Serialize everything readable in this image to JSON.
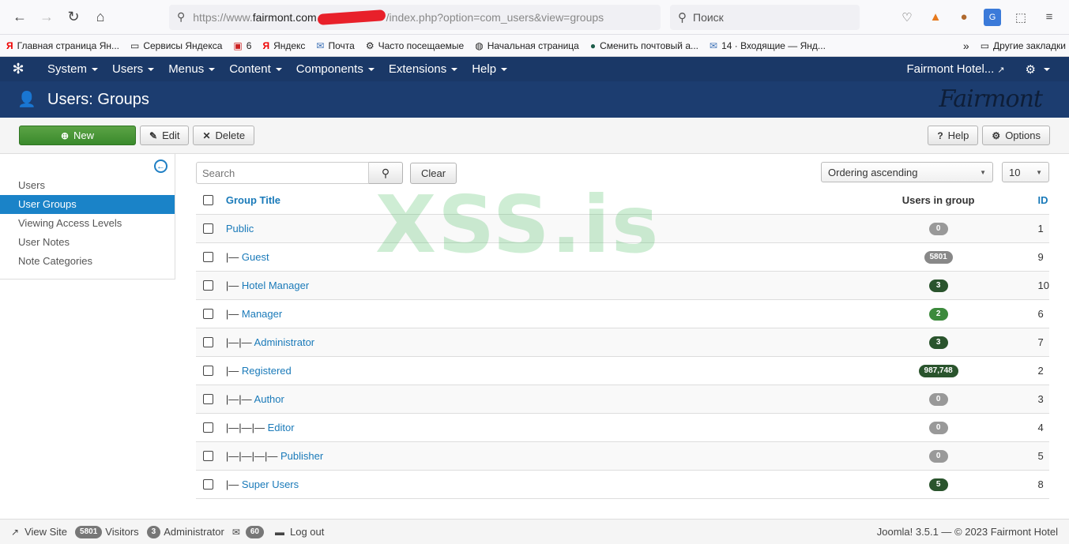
{
  "browser": {
    "url_prefix": "https://www.",
    "url_host": "fairmont.com",
    "url_path": "/index.php?option=com_users&view=groups",
    "search_placeholder": "Поиск",
    "bookmarks": [
      {
        "label": "Главная страница Ян...",
        "icon": "yandex-icon"
      },
      {
        "label": "Сервисы Яндекса",
        "icon": "folder-icon"
      },
      {
        "label": "6",
        "icon": "mail-icon"
      },
      {
        "label": "Яндекс",
        "icon": "yandex-icon"
      },
      {
        "label": "Почта",
        "icon": "mail-icon"
      },
      {
        "label": "Часто посещаемые",
        "icon": "gear-icon"
      },
      {
        "label": "Начальная страница",
        "icon": "globe-icon"
      },
      {
        "label": "Сменить почтовый а...",
        "icon": "site-icon"
      },
      {
        "label": "14 · Входящие — Янд...",
        "icon": "mail-icon"
      }
    ],
    "other_bookmarks": "Другие закладки"
  },
  "nav": {
    "menus": [
      "System",
      "Users",
      "Menus",
      "Content",
      "Components",
      "Extensions",
      "Help"
    ],
    "site_name": "Fairmont Hotel..."
  },
  "header": {
    "title": "Users: Groups",
    "brand": "Fairmont"
  },
  "toolbar": {
    "new_label": "New",
    "edit_label": "Edit",
    "delete_label": "Delete",
    "help_label": "Help",
    "options_label": "Options"
  },
  "sidebar": {
    "items": [
      "Users",
      "User Groups",
      "Viewing Access Levels",
      "User Notes",
      "Note Categories"
    ],
    "active_index": 1
  },
  "filters": {
    "search_placeholder": "Search",
    "clear_label": "Clear",
    "ordering": "Ordering ascending",
    "limit": "10"
  },
  "table": {
    "headers": {
      "title": "Group Title",
      "users": "Users in group",
      "id": "ID"
    },
    "rows": [
      {
        "prefix": "",
        "title": "Public",
        "users": "0",
        "id": "1",
        "badge": "zero"
      },
      {
        "prefix": "|— ",
        "title": "Guest",
        "users": "5801",
        "id": "9",
        "badge": "grey"
      },
      {
        "prefix": "|— ",
        "title": "Hotel Manager",
        "users": "3",
        "id": "10",
        "badge": "dark"
      },
      {
        "prefix": "|— ",
        "title": "Manager",
        "users": "2",
        "id": "6",
        "badge": "green"
      },
      {
        "prefix": "|—|— ",
        "title": "Administrator",
        "users": "3",
        "id": "7",
        "badge": "dark"
      },
      {
        "prefix": "|— ",
        "title": "Registered",
        "users": "987,748",
        "id": "2",
        "badge": "dark"
      },
      {
        "prefix": "|—|— ",
        "title": "Author",
        "users": "0",
        "id": "3",
        "badge": "zero"
      },
      {
        "prefix": "|—|—|— ",
        "title": "Editor",
        "users": "0",
        "id": "4",
        "badge": "zero"
      },
      {
        "prefix": "|—|—|—|— ",
        "title": "Publisher",
        "users": "0",
        "id": "5",
        "badge": "zero"
      },
      {
        "prefix": "|— ",
        "title": "Super Users",
        "users": "5",
        "id": "8",
        "badge": "dark"
      }
    ]
  },
  "watermark": "XSS.is",
  "status": {
    "view_site": "View Site",
    "visitors_count": "5801",
    "visitors_label": "Visitors",
    "admin_count": "3",
    "admin_label": "Administrator",
    "messages_count": "60",
    "logout_label": "Log out",
    "footer": "Joomla! 3.5.1  —  © 2023 Fairmont Hotel"
  }
}
